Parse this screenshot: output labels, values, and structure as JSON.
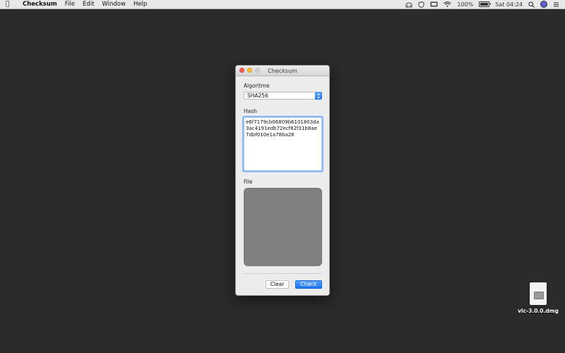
{
  "menubar": {
    "app_name": "Checksum",
    "items": [
      "File",
      "Edit",
      "Window",
      "Help"
    ],
    "status": {
      "battery_text": "100%",
      "battery_level": 1.0,
      "clock": "Sat 04:24"
    },
    "icons": [
      "apple-icon",
      "timemachine-icon",
      "shield-icon",
      "display-icon",
      "wifi-icon",
      "battery-icon",
      "search-icon",
      "siri-icon",
      "user-icon"
    ]
  },
  "window": {
    "title": "Checksum",
    "algorithm": {
      "label": "Algoritme",
      "selected": "SHA256"
    },
    "hash": {
      "label": "Hash",
      "value": "e6f7179cb06809b6101803da3ac4191edb72ecf82f31b8ae7dbf010e1a78ba26"
    },
    "file": {
      "label": "File"
    },
    "buttons": {
      "clear": "Clear",
      "check": "Check"
    }
  },
  "desktop": {
    "file_name": "vlc-3.0.0.dmg"
  },
  "colors": {
    "desktop": "#2b2b2b",
    "accent": "#1c73f0",
    "drop_area": "#808080"
  }
}
